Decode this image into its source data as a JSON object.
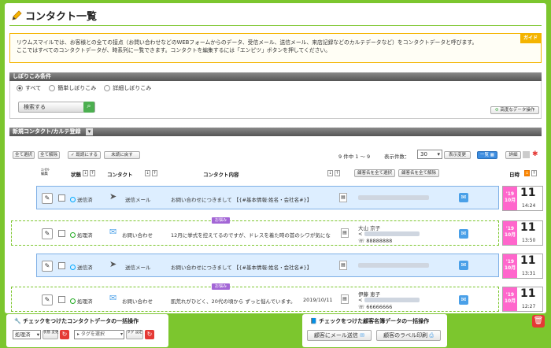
{
  "page": {
    "title": "コンタクト一覧"
  },
  "guide": {
    "badge": "ガイド",
    "line1": "リウムスマイルでは、お客様との全ての接点（お問い合わせなどのWEBフォームからのデータ、受信メール、送信メール、来店記録などのカルテデータなど）をコンタクトデータと呼びます。",
    "line2": "ここではすべてのコンタクトデータが、時系列に一覧できます。コンタクトを編集するには「エンピツ」ボタンを押してください。"
  },
  "filter": {
    "header": "しぼりこみ条件",
    "options": [
      "すべて",
      "簡単しぼりこみ",
      "詳細しぼりこみ"
    ],
    "selected": "すべて",
    "search_label": "検索する",
    "advanced_label": "高度なデータ操作"
  },
  "new_contact": {
    "header": "新規コンタクト/カルテ登録"
  },
  "toolbar": {
    "select_all": "全て選択",
    "clear_all": "全て解除",
    "mark_processed": "✓ 既読にする",
    "mark_unprocessed": "未読に戻す",
    "count_text": "9 件中 1 ～ 9",
    "display_count_label": "表示件数：",
    "display_count_value": "30",
    "display_change": "表示変更",
    "view_list": "一覧",
    "view_detail": "詳細"
  },
  "columns": {
    "contact_edit": "ｺﾝﾀｸﾄ 編集",
    "status": "状態",
    "contact": "コンタクト",
    "contact_content": "コンタクト内容",
    "select_customer_all": "顧客名を全て選択",
    "clear_customer_all": "顧客名を全て解除",
    "date": "日時"
  },
  "rows": [
    {
      "type": "sent",
      "status": "送信済",
      "status_color": "#00aaff",
      "contact": "送信メール",
      "content": "お問い合わせにつきまして 【{#基本情報:姓名・会社名#}】",
      "tag": "",
      "customer_name": "",
      "customer_tel": "",
      "date_ym": "'19 10月",
      "day": "11",
      "time": "14:24"
    },
    {
      "type": "proc",
      "status": "処理済",
      "status_color": "#22aa22",
      "contact": "お問い合わせ",
      "content": "12月に挙式を控えてるのですが、ドレスを着た時の首のシワが気にな",
      "tag": "お悩み",
      "customer_name": "大山 京子",
      "customer_tel": "88888888",
      "date_ym": "'19 10月",
      "day": "11",
      "time": "13:50"
    },
    {
      "type": "sent",
      "status": "送信済",
      "status_color": "#00aaff",
      "contact": "送信メール",
      "content": "お問い合わせにつきまして 【{#基本情報:姓名・会社名#}】",
      "tag": "",
      "customer_name": "",
      "customer_tel": "",
      "date_ym": "'19 10月",
      "day": "11",
      "time": "13:31"
    },
    {
      "type": "proc",
      "status": "処理済",
      "status_color": "#22aa22",
      "contact": "お問い合わせ",
      "content": "肌荒れがひどく、20代の頃から ずっと悩んでいます。",
      "extra_date": "2019/10/11",
      "tag": "お悩み",
      "customer_name": "伊藤 恵子",
      "customer_tel": "66666666",
      "date_ym": "'19 10月",
      "day": "11",
      "time": "12:27"
    }
  ],
  "bulk_contact": {
    "header": "チェックをつけたコンタクトデータの一括操作",
    "status_value": "処理済",
    "status_change": "状態 変更",
    "tag_placeholder": "タグを選択",
    "tag_set": "タグ 設定"
  },
  "bulk_customer": {
    "header": "チェックをつけた顧客名簿データの一括操作",
    "send_mail": "顧客にメール送信",
    "print_label": "顧客のラベル印刷"
  }
}
